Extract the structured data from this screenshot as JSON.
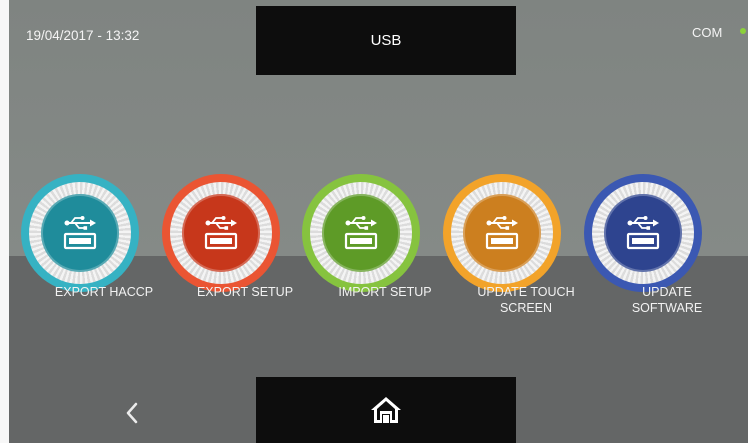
{
  "header": {
    "datetime": "19/04/2017 - 13:32",
    "title": "USB",
    "status_label": "COM",
    "status_color": "#8cd13a"
  },
  "functions": [
    {
      "label": "EXPORT HACCP",
      "outer_color": "#36b2c3",
      "core_color": "#1f8c9b",
      "icon": "usb-icon"
    },
    {
      "label": "EXPORT SETUP",
      "outer_color": "#ea5533",
      "core_color": "#c7371b",
      "icon": "usb-icon"
    },
    {
      "label": "IMPORT SETUP",
      "outer_color": "#86c33f",
      "core_color": "#5e9b27",
      "icon": "usb-icon"
    },
    {
      "label": "UPDATE TOUCH SCREEN",
      "outer_color": "#f2a32a",
      "core_color": "#cc7f1f",
      "icon": "usb-icon"
    },
    {
      "label": "UPDATE SOFTWARE",
      "outer_color": "#3b58b2",
      "core_color": "#2e448f",
      "icon": "usb-icon"
    }
  ],
  "footer": {
    "back_icon": "chevron-left-icon",
    "home_icon": "home-icon"
  }
}
